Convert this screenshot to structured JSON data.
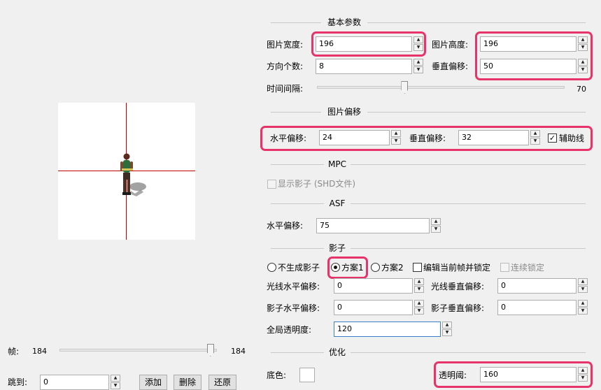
{
  "preview": {
    "frame_label": "帧:",
    "frame_value": "184",
    "frame_max": "184",
    "frame_fraction": 1.0,
    "goto_label": "跳到:",
    "goto_value": "0",
    "add_label": "添加",
    "delete_label": "删除",
    "restore_label": "还原"
  },
  "basic": {
    "title": "基本参数",
    "width_label": "图片宽度:",
    "width_value": "196",
    "height_label": "图片高度:",
    "height_value": "196",
    "directions_label": "方向个数:",
    "directions_value": "8",
    "voffset_label": "垂直偏移:",
    "voffset_value": "50",
    "interval_label": "时间间隔:",
    "interval_value": "70",
    "interval_fraction": 0.35
  },
  "offset": {
    "title": "图片偏移",
    "h_label": "水平偏移:",
    "h_value": "24",
    "v_label": "垂直偏移:",
    "v_value": "32",
    "guide_label": "辅助线",
    "guide_checked": true
  },
  "mpc": {
    "title": "MPC",
    "shadow_label": "显示影子 (SHD文件)"
  },
  "asf": {
    "title": "ASF",
    "h_label": "水平偏移:",
    "h_value": "75"
  },
  "shadow": {
    "title": "影子",
    "none_label": "不生成影子",
    "plan1_label": "方案1",
    "plan2_label": "方案2",
    "edit_lock_label": "编辑当前帧并锁定",
    "cont_lock_label": "连续锁定",
    "light_h_label": "光线水平偏移:",
    "light_h_value": "0",
    "light_v_label": "光线垂直偏移:",
    "light_v_value": "0",
    "shadow_h_label": "影子水平偏移:",
    "shadow_h_value": "0",
    "shadow_v_label": "影子垂直偏移:",
    "shadow_v_value": "0",
    "alpha_label": "全局透明度:",
    "alpha_value": "120"
  },
  "optimize": {
    "title": "优化",
    "bg_label": "底色:",
    "threshold_label": "透明阈:",
    "threshold_value": "160"
  },
  "colors": {
    "highlight": "#e8336a",
    "crosshair": "#c00000",
    "canvas": "#ffffff",
    "window": "#f0f0f0"
  }
}
